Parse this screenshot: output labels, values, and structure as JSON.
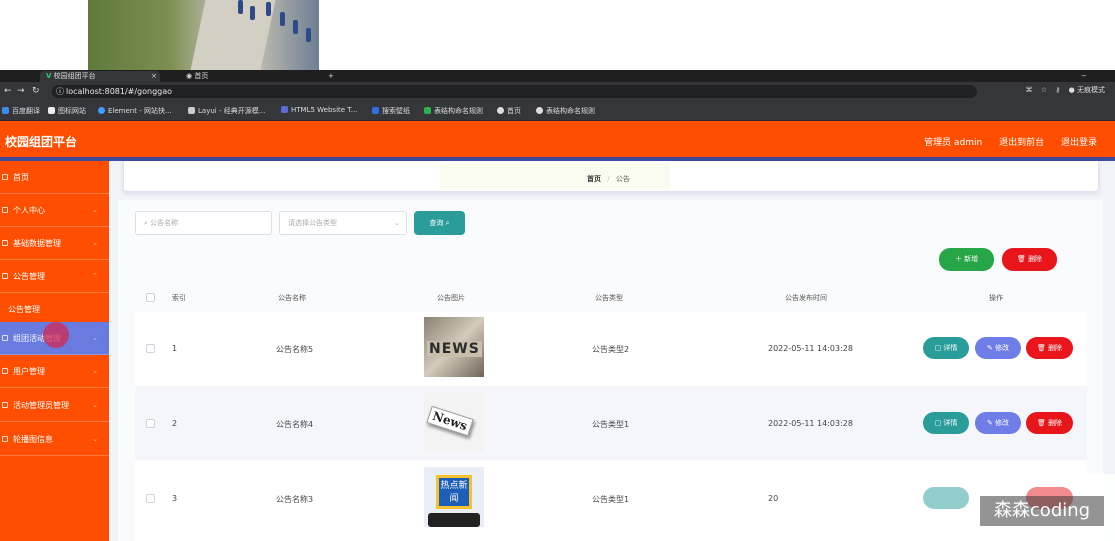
{
  "browser": {
    "tabs": [
      {
        "label": "校园组团平台"
      },
      {
        "label": "首页"
      }
    ],
    "url": "localhost:8081/#/gonggao",
    "profile": "无痕模式",
    "bookmarks": [
      "百度翻译",
      "图标网站",
      "Element - 网站快...",
      "Layui - 经典开源模...",
      "HTML5 Website T...",
      "搜索壁纸",
      "表结构命名规则",
      "首页",
      "表结构命名规则"
    ]
  },
  "header": {
    "title": "校园组团平台",
    "user": "管理员 admin",
    "back_to_front": "退出到前台",
    "logout": "退出登录"
  },
  "sidebar": {
    "items": [
      {
        "label": "首页"
      },
      {
        "label": "个人中心"
      },
      {
        "label": "基础数据管理"
      },
      {
        "label": "公告管理"
      },
      {
        "label": "公告管理"
      },
      {
        "label": "组团活动管理"
      },
      {
        "label": "用户管理"
      },
      {
        "label": "活动管理员管理"
      },
      {
        "label": "轮播图信息"
      }
    ]
  },
  "breadcrumb": {
    "home": "首页",
    "sep": "/",
    "current": "公告"
  },
  "search": {
    "name_placeholder": "公告名称",
    "type_placeholder": "请选择公告类型",
    "query_label": "查询"
  },
  "actions": {
    "add_label": "新增",
    "delete_label": "删除"
  },
  "table": {
    "headers": [
      "索引",
      "公告名称",
      "公告图片",
      "公告类型",
      "公告发布时间",
      "操作"
    ],
    "rows": [
      {
        "index": "1",
        "name": "公告名称5",
        "type": "公告类型2",
        "time": "2022-05-11 14:03:28"
      },
      {
        "index": "2",
        "name": "公告名称4",
        "type": "公告类型1",
        "time": "2022-05-11 14:03:28"
      },
      {
        "index": "3",
        "name": "公告名称3",
        "type": "公告类型1",
        "time": "20"
      }
    ],
    "row_actions": {
      "detail": "详情",
      "edit": "修改",
      "delete": "删除"
    },
    "thumb_text": {
      "news1": "NEWS",
      "news2": "News",
      "news3": "热点新闻"
    }
  },
  "watermark": "森森coding",
  "colors": {
    "primary": "#ff4e00",
    "active_menu": "#6a7be0",
    "teal": "#2a9d9a",
    "green": "#27a647",
    "red": "#e8161b",
    "blue": "#6f7de6"
  }
}
